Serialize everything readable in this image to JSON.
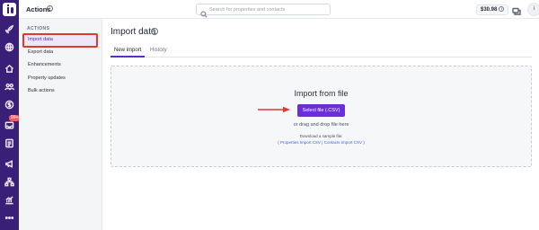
{
  "header": {
    "title": "Actions",
    "info_icon": "info-icon",
    "search_placeholder": "Search for properties and contacts",
    "balance": "$30.98",
    "chat_icon": "chat-icon",
    "avatar_letter": "i"
  },
  "rail": {
    "badge": "99+",
    "icons": [
      "rocket-icon",
      "globe-icon",
      "home-icon",
      "people-icon",
      "dollar-icon",
      "inbox-icon",
      "document-icon",
      "megaphone-icon",
      "org-chart-icon",
      "analytics-icon",
      "more-icon"
    ]
  },
  "sidebar": {
    "heading": "ACTIONS",
    "items": [
      {
        "label": "Import data",
        "active": true
      },
      {
        "label": "Export data",
        "active": false
      },
      {
        "label": "Enhancements",
        "active": false
      },
      {
        "label": "Property updates",
        "active": false
      },
      {
        "label": "Bulk actions",
        "active": false
      }
    ]
  },
  "main": {
    "title": "Import data",
    "tabs": [
      {
        "label": "New import",
        "active": true
      },
      {
        "label": "History",
        "active": false
      }
    ],
    "dropzone": {
      "title": "Import from file",
      "button": "Select file (.CSV)",
      "or_text": "or drag and drop file here",
      "sample_text": "Download a sample file:",
      "link_open": "(",
      "link_properties": "Properties Import CSV",
      "link_sep": "|",
      "link_contacts": "Contacts Import CSV",
      "link_close": ")"
    }
  },
  "colors": {
    "rail": "#3a1f78",
    "accent": "#6a2fd8",
    "annotation": "#e03a2f"
  }
}
